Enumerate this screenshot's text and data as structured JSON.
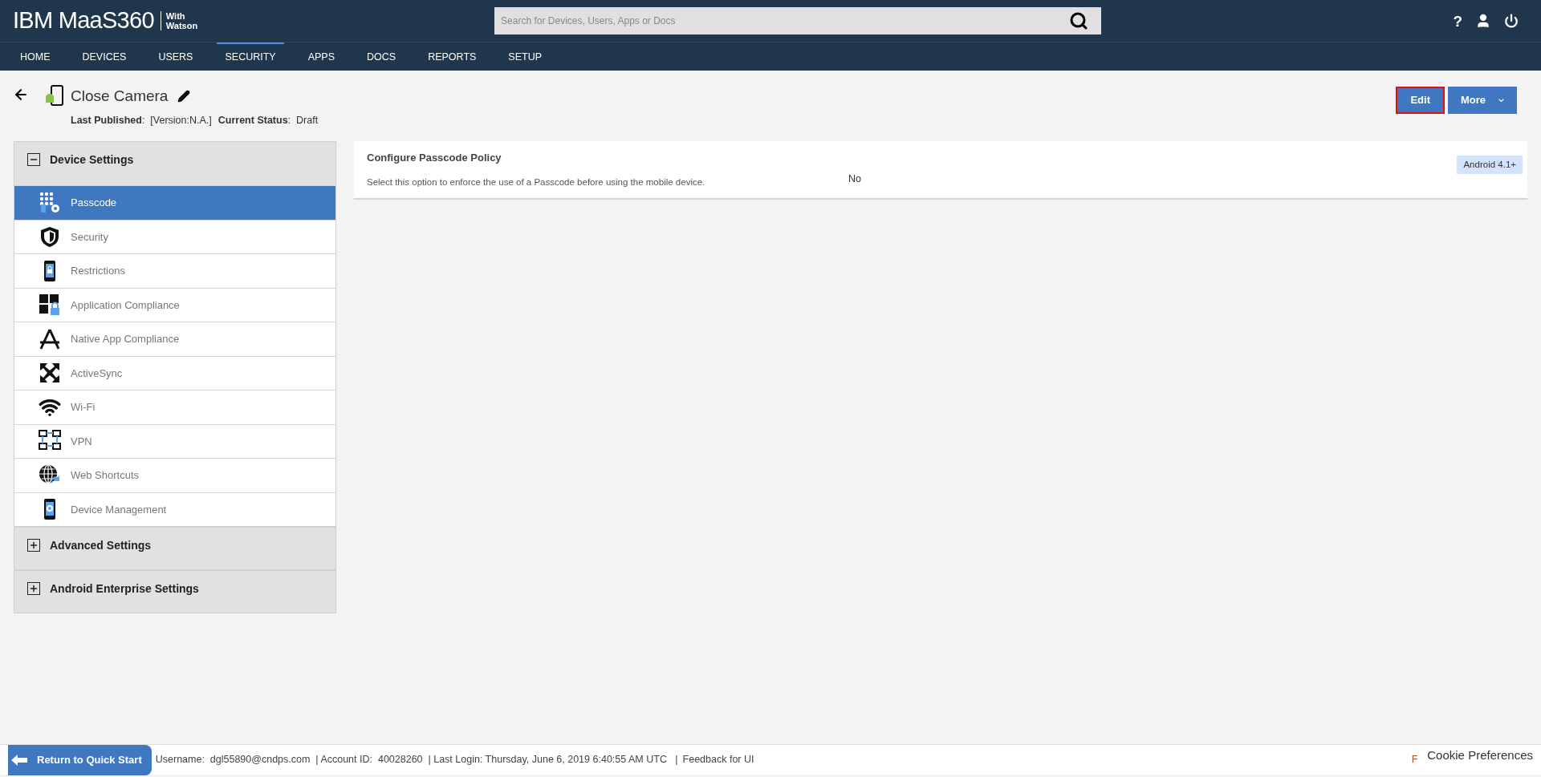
{
  "header": {
    "logo": "IBM MaaS360",
    "logo_tag_1": "With",
    "logo_tag_2": "Watson",
    "help": "?",
    "search": {
      "placeholder": "Search for Devices, Users, Apps or Docs"
    }
  },
  "nav": [
    {
      "label": "HOME",
      "selected": false
    },
    {
      "label": "DEVICES",
      "selected": false
    },
    {
      "label": "USERS",
      "selected": false
    },
    {
      "label": "SECURITY",
      "selected": true
    },
    {
      "label": "APPS",
      "selected": false
    },
    {
      "label": "DOCS",
      "selected": false
    },
    {
      "label": "REPORTS",
      "selected": false
    },
    {
      "label": "SETUP",
      "selected": false
    }
  ],
  "policy": {
    "title": "Close Camera",
    "meta": [
      {
        "label": "Last Published",
        "sep": ":",
        "value": "[Version:N.A.]"
      },
      {
        "label": "Current Status",
        "sep": ":",
        "value": "Draft"
      }
    ]
  },
  "actions": [
    {
      "label": "Edit",
      "highlighted": true,
      "kind": "button"
    },
    {
      "label": "More",
      "highlighted": false,
      "kind": "dropdown"
    }
  ],
  "sidebar": [
    {
      "label": "Device Settings",
      "expanded": true,
      "children": [
        {
          "label": "Passcode",
          "selected": true
        },
        {
          "label": "Security",
          "selected": false
        },
        {
          "label": "Restrictions",
          "selected": false
        },
        {
          "label": "Application Compliance",
          "selected": false
        },
        {
          "label": "Native App Compliance",
          "selected": false
        },
        {
          "label": "ActiveSync",
          "selected": false
        },
        {
          "label": "Wi-Fi",
          "selected": false
        },
        {
          "label": "VPN",
          "selected": false
        },
        {
          "label": "Web Shortcuts",
          "selected": false
        },
        {
          "label": "Device Management",
          "selected": false
        }
      ]
    },
    {
      "label": "Advanced Settings",
      "expanded": false
    },
    {
      "label": "Android Enterprise Settings",
      "expanded": false
    }
  ],
  "settings": [
    {
      "title": "Configure Passcode Policy",
      "description": "Select this option to enforce the use of a Passcode before using the mobile device.",
      "value": "No",
      "badge": "Android 4.1+"
    }
  ],
  "footer": {
    "return_button": "Return to Quick Start",
    "info": "Username:  dgl55890@cndps.com  | Account ID:  40028260  | Last Login: Thursday, June 6, 2019 6:40:55 AM UTC   |",
    "feedback_link": "Feedback for UI",
    "cut_text": "F",
    "cookie_link": "Cookie Preferences"
  }
}
